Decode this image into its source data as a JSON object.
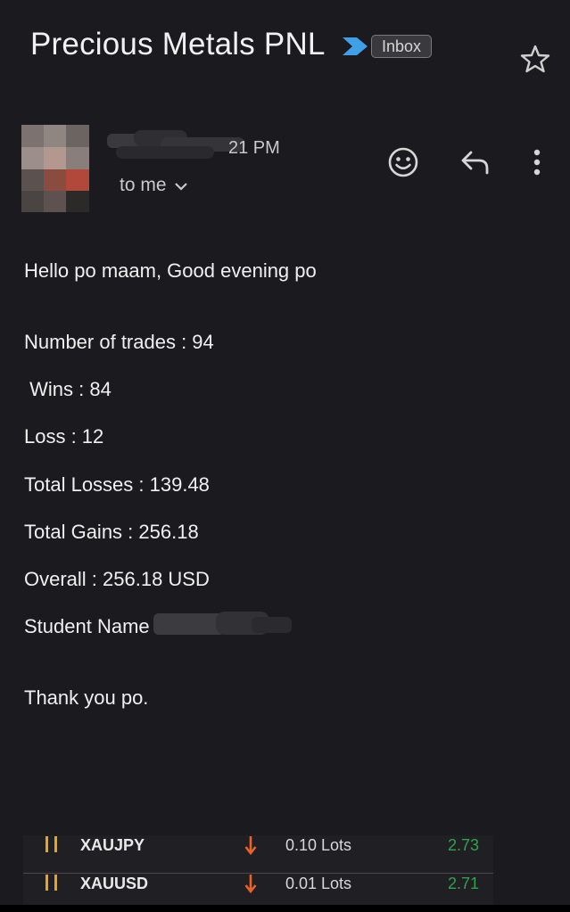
{
  "header": {
    "subject": "Precious Metals PNL",
    "label": "Inbox",
    "importance_icon": "importance-marker-icon",
    "star_icon": "star-outline-icon"
  },
  "sender": {
    "time": "21 PM",
    "to_me": "to me",
    "actions": [
      "add-reaction-icon",
      "reply-icon",
      "more-vert-icon"
    ]
  },
  "body": {
    "greeting": "Hello po maam, Good evening po",
    "number_of_trades": "Number of trades : 94",
    "wins": " Wins : 84",
    "loss": "Loss : 12",
    "total_losses": "Total Losses : 139.48",
    "total_gains": "Total Gains : 256.18",
    "overall": "Overall : 256.18 USD",
    "student_name": "Student Name",
    "closing": "Thank you po."
  },
  "trades": [
    {
      "symbol": "XAUJPY",
      "direction": "down",
      "lots": "0.10 Lots",
      "profit": "2.73"
    },
    {
      "symbol": "XAUUSD",
      "direction": "down",
      "lots": "0.01 Lots",
      "profit": "2.71"
    }
  ],
  "colors": {
    "background": "#1b1b1f",
    "importance_blue": "#3fa0e8",
    "trade_bar": "#e8a321",
    "sell_arrow": "#e8622a",
    "profit_green": "#2fa24d"
  }
}
